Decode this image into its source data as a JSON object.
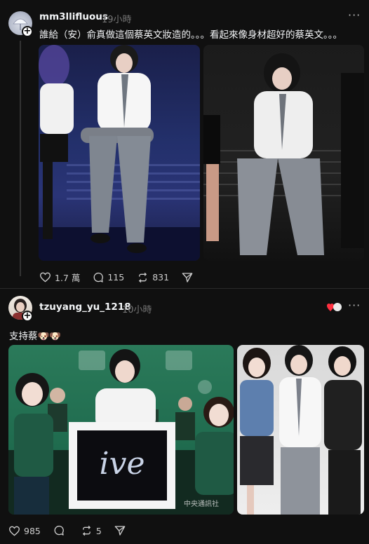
{
  "posts": [
    {
      "username": "mm3llifluous",
      "time": "19小時",
      "text": "誰給（安）俞真做這個蔡英文妝造的。。。看起來像身材超好的蔡英文。。。",
      "likes": "1.7 萬",
      "comments": "115",
      "reposts": "831"
    },
    {
      "username": "tzuyang_yu_1218",
      "time": "10小時",
      "text": "支持蔡🐶🐶",
      "likes": "985",
      "comments": "",
      "reposts": "5",
      "overlay_logo": "ive",
      "watermark": "中央通訊社"
    }
  ],
  "colors": {
    "background": "#101010",
    "stage_blue": "#1c2456",
    "green_backdrop": "#1f6b4e",
    "heart": "#ff3040"
  }
}
